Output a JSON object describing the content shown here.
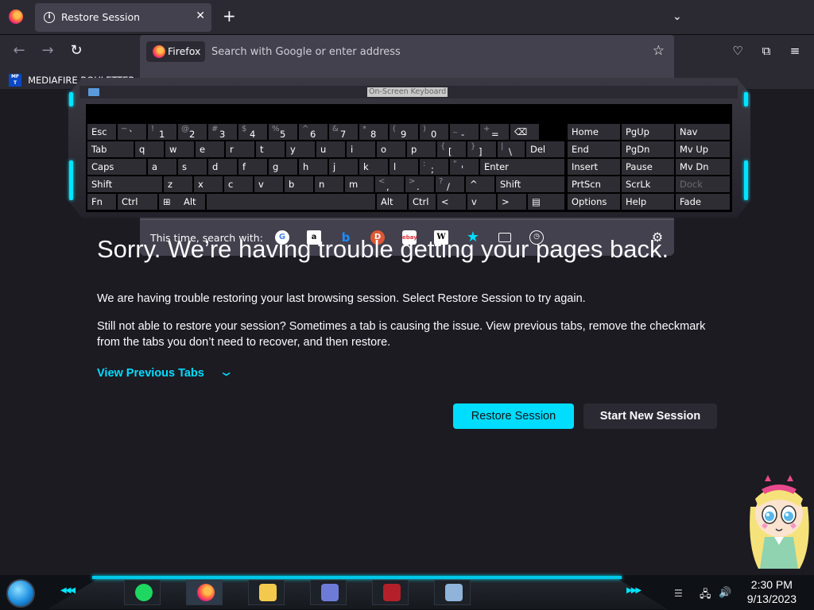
{
  "browser": {
    "tab_title": "Restore Session",
    "new_tab_label": "+",
    "identity_label": "Firefox",
    "url_placeholder": "Search with Google or enter address",
    "bookmark_label": "MEDIAFIRE ROULETTER",
    "bookmark_icon_text": "MF T"
  },
  "search_oneoffs": {
    "label": "This time, search with:",
    "engines": [
      "google-icon",
      "amazon-icon",
      "bing-icon",
      "duckduckgo-icon",
      "ebay-icon",
      "wikipedia-icon",
      "bookmarks-icon",
      "tabs-icon",
      "history-icon",
      "settings-icon"
    ]
  },
  "osk": {
    "title": "On-Screen Keyboard",
    "rows": [
      [
        {
          "main": "Esc"
        },
        {
          "shift": "~",
          "main": "`"
        },
        {
          "shift": "!",
          "main": "1"
        },
        {
          "shift": "@",
          "main": "2"
        },
        {
          "shift": "#",
          "main": "3"
        },
        {
          "shift": "$",
          "main": "4"
        },
        {
          "shift": "%",
          "main": "5"
        },
        {
          "shift": "^",
          "main": "6"
        },
        {
          "shift": "&",
          "main": "7"
        },
        {
          "shift": "*",
          "main": "8"
        },
        {
          "shift": "(",
          "main": "9"
        },
        {
          "shift": ")",
          "main": "0"
        },
        {
          "shift": "_",
          "main": "-"
        },
        {
          "shift": "+",
          "main": "="
        },
        {
          "main": "⌫"
        }
      ],
      [
        {
          "main": "Tab"
        },
        {
          "main": "q"
        },
        {
          "main": "w"
        },
        {
          "main": "e"
        },
        {
          "main": "r"
        },
        {
          "main": "t"
        },
        {
          "main": "y"
        },
        {
          "main": "u"
        },
        {
          "main": "i"
        },
        {
          "main": "o"
        },
        {
          "main": "p"
        },
        {
          "shift": "{",
          "main": "["
        },
        {
          "shift": "}",
          "main": "]"
        },
        {
          "shift": "|",
          "main": "\\"
        },
        {
          "main": "Del"
        }
      ],
      [
        {
          "main": "Caps"
        },
        {
          "main": "a"
        },
        {
          "main": "s"
        },
        {
          "main": "d"
        },
        {
          "main": "f"
        },
        {
          "main": "g"
        },
        {
          "main": "h"
        },
        {
          "main": "j"
        },
        {
          "main": "k"
        },
        {
          "main": "l"
        },
        {
          "shift": ":",
          "main": ";"
        },
        {
          "shift": "\"",
          "main": "'"
        },
        {
          "main": "Enter"
        }
      ],
      [
        {
          "main": "Shift"
        },
        {
          "main": "z"
        },
        {
          "main": "x"
        },
        {
          "main": "c"
        },
        {
          "main": "v"
        },
        {
          "main": "b"
        },
        {
          "main": "n"
        },
        {
          "main": "m"
        },
        {
          "shift": "<",
          "main": ","
        },
        {
          "shift": ">",
          "main": "."
        },
        {
          "shift": "?",
          "main": "/"
        },
        {
          "main": "^"
        },
        {
          "main": "Shift"
        }
      ],
      [
        {
          "main": "Fn"
        },
        {
          "main": "Ctrl"
        },
        {
          "main": "⊞"
        },
        {
          "main": "Alt"
        },
        {
          "main": ""
        },
        {
          "main": "Alt"
        },
        {
          "main": "Ctrl"
        },
        {
          "main": "<"
        },
        {
          "main": "v"
        },
        {
          "main": ">"
        },
        {
          "main": "▤"
        }
      ]
    ],
    "nav_keys": [
      [
        "Home",
        "PgUp",
        "Nav"
      ],
      [
        "End",
        "PgDn",
        "Mv Up"
      ],
      [
        "Insert",
        "Pause",
        "Mv Dn"
      ],
      [
        "PrtScn",
        "ScrLk",
        "Dock"
      ],
      [
        "Options",
        "Help",
        "Fade"
      ]
    ]
  },
  "page": {
    "heading": "Sorry. We’re having trouble getting your pages back.",
    "paragraph1": "We are having trouble restoring your last browsing session. Select Restore Session to try again.",
    "paragraph2": "Still not able to restore your session? Sometimes a tab is causing the issue. View previous tabs, remove the checkmark from the tabs you don’t need to recover, and then restore.",
    "view_tabs_label": "View Previous Tabs",
    "restore_label": "Restore Session",
    "new_session_label": "Start New Session"
  },
  "taskbar": {
    "apps": [
      "spotify-icon",
      "firefox-icon",
      "file-explorer-icon",
      "media-app-icon",
      "game-app-icon",
      "remote-desktop-icon"
    ],
    "time": "2:30 PM",
    "date": "9/13/2023"
  }
}
